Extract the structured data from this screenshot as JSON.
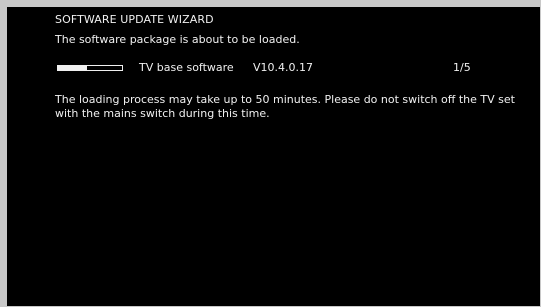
{
  "wizard": {
    "title": "SOFTWARE UPDATE WIZARD",
    "subtitle": "The software package is about to be loaded."
  },
  "package": {
    "progress_fraction": 0.45,
    "name": "TV base software",
    "version": "V10.4.0.17",
    "counter": "1/5"
  },
  "info_text": "The loading process may take up to 50 minutes. Please do not switch off the TV set with the mains switch during this time.",
  "colors": {
    "screen_background": "#000000",
    "text": "#f0f0f0",
    "frame": "#c8c8c8"
  }
}
